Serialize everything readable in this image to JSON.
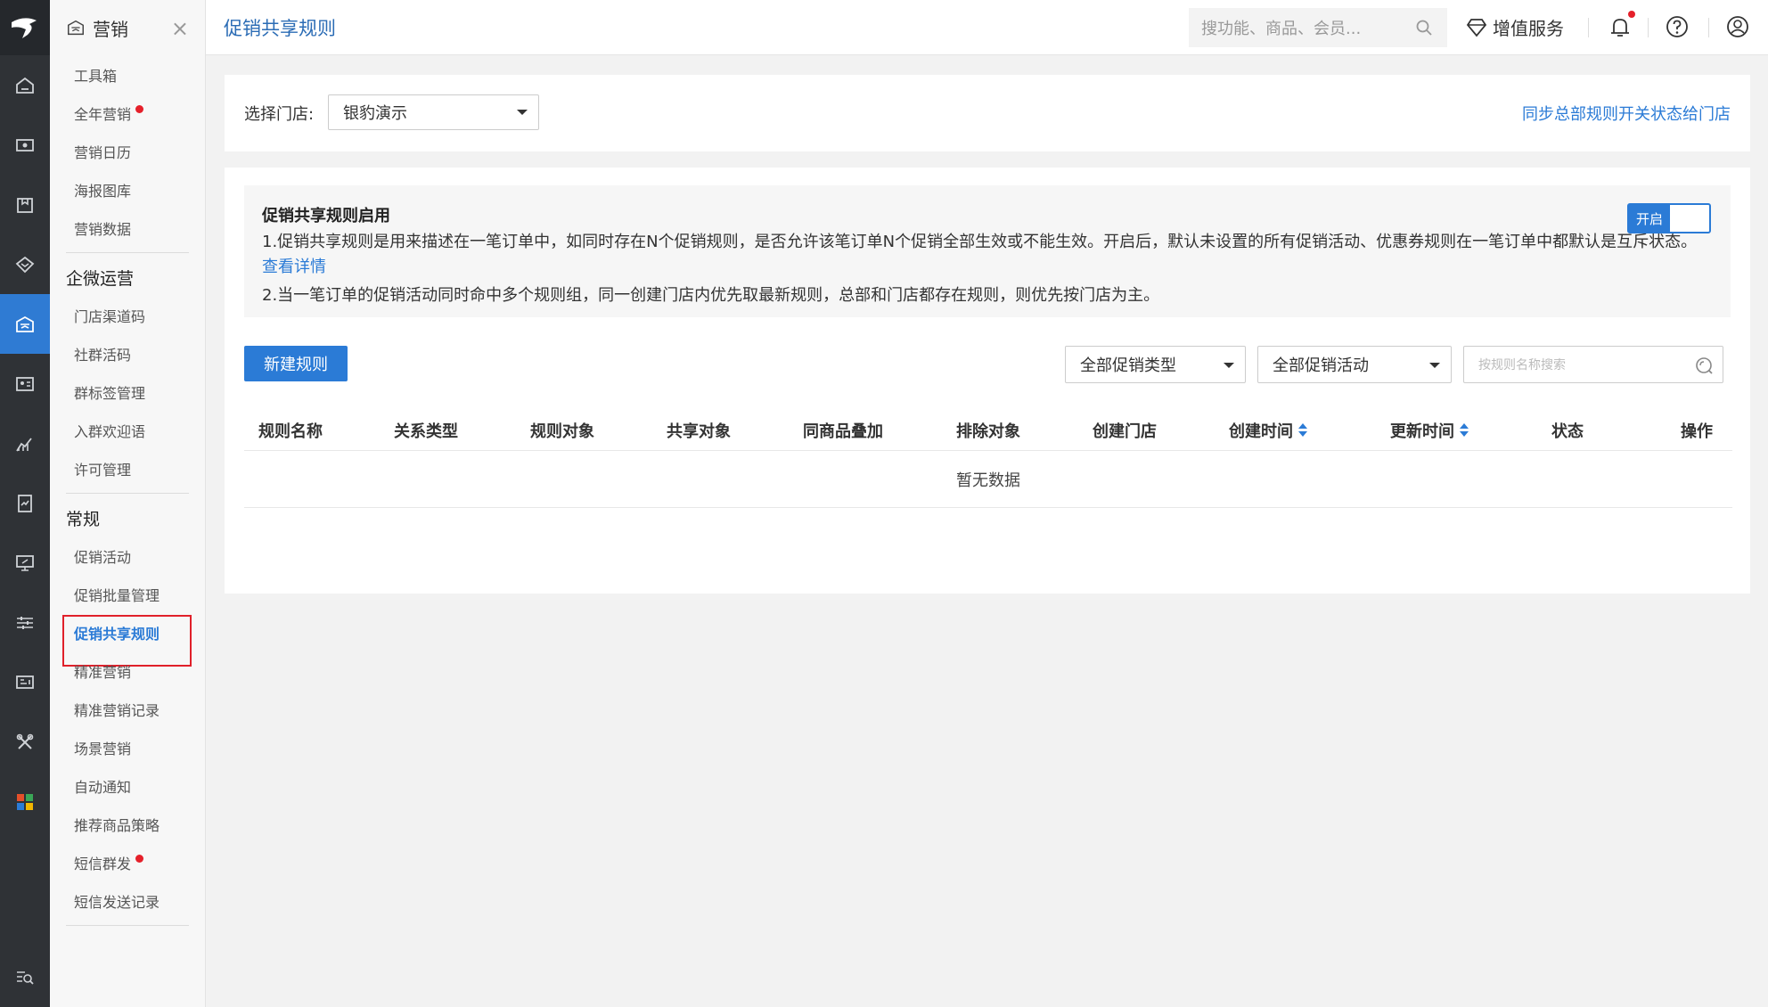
{
  "sidebar": {
    "title": "营销",
    "close": "×",
    "items_a": [
      "工具箱",
      "全年营销",
      "营销日历",
      "海报图库",
      "营销数据"
    ],
    "group_qw": "企微运营",
    "items_b": [
      "门店渠道码",
      "社群活码",
      "群标签管理",
      "入群欢迎语",
      "许可管理"
    ],
    "group_cg": "常规",
    "items_c": [
      "促销活动",
      "促销批量管理",
      "促销共享规则",
      "精准营销",
      "精准营销记录",
      "场景营销",
      "自动通知",
      "推荐商品策略",
      "短信群发",
      "短信发送记录"
    ],
    "active_item": "促销共享规则",
    "dot_items": [
      "全年营销",
      "短信群发"
    ]
  },
  "rail": {
    "icons": [
      "home-icon",
      "cash-icon",
      "box-icon",
      "tag-icon",
      "marketing-icon",
      "member-card-icon",
      "chart-icon",
      "report-icon",
      "monitor-icon",
      "settings-sliders-icon",
      "device-icon",
      "tools-icon",
      "apps-icon"
    ],
    "active_index": 4
  },
  "topbar": {
    "title": "促销共享规则",
    "search_placeholder": "搜功能、商品、会员...",
    "value_services": "增值服务"
  },
  "store": {
    "label": "选择门店:",
    "selected": "银豹演示",
    "sync_link": "同步总部规则开关状态给门店"
  },
  "info": {
    "title": "促销共享规则启用",
    "line1": "1.促销共享规则是用来描述在一笔订单中，如同时存在N个促销规则，是否允许该笔订单N个促销全部生效或不能生效。开启后，默认未设置的所有促销活动、优惠券规则在一笔订单中都默认是互斥状态。",
    "detail_link": "查看详情",
    "line2": "2.当一笔订单的促销活动同时命中多个规则组，同一创建门店内优先取最新规则，总部和门店都存在规则，则优先按门店为主。",
    "toggle_label": "开启"
  },
  "toolbar": {
    "new_rule": "新建规则",
    "filter_type": "全部促销类型",
    "filter_activity": "全部促销活动",
    "search_placeholder": "按规则名称搜索"
  },
  "table": {
    "columns": [
      "规则名称",
      "关系类型",
      "规则对象",
      "共享对象",
      "同商品叠加",
      "排除对象",
      "创建门店",
      "创建时间",
      "更新时间",
      "状态",
      "操作"
    ],
    "empty_text": "暂无数据"
  },
  "colors": {
    "accent": "#2b7bd6",
    "rail_bg": "#2f3236",
    "alert_red": "#e5202a"
  }
}
